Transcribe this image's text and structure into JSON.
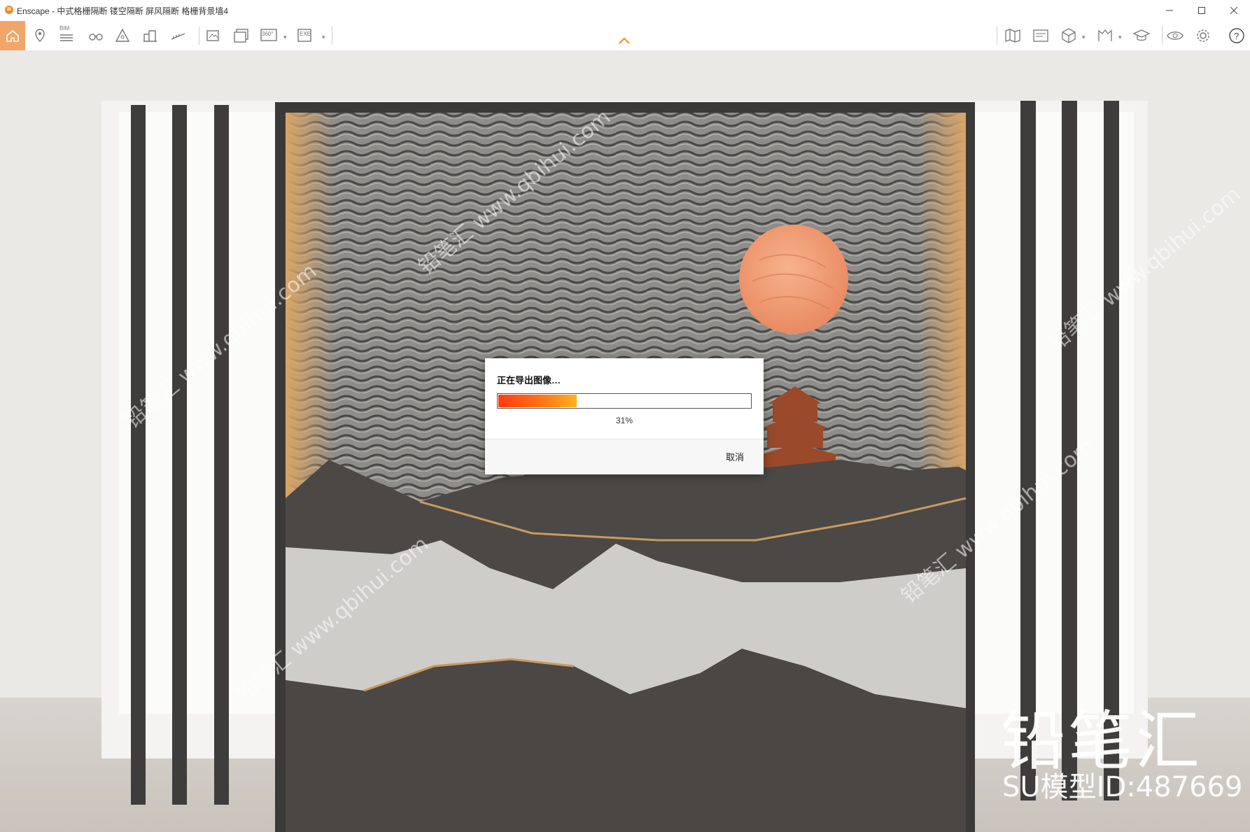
{
  "window": {
    "title": "Enscape - 中式格栅隔断 镂空隔断 屏风隔断 格栅背景墙4"
  },
  "toolbar": {
    "icons": [
      "home-icon",
      "location-pin-icon",
      "bim-list-icon",
      "binoculars-icon",
      "warning-icon",
      "buildings-icon",
      "ruler-icon",
      "screenshot-icon",
      "batch-render-icon",
      "panorama-360-icon",
      "exe-export-icon",
      "map-icon",
      "render-settings-icon",
      "cube-icon",
      "assets-icon",
      "graduation-cap-icon",
      "eye-icon",
      "gear-icon",
      "help-icon"
    ],
    "bim_label": "BIM",
    "panorama_label": "360°",
    "exe_label": "EXE",
    "accent_color": "#f2a56a"
  },
  "dialog": {
    "title": "正在导出图像…",
    "progress_percent": 31,
    "progress_label": "31%",
    "cancel_label": "取消"
  },
  "watermark": {
    "brand": "铅笔汇",
    "model_id": "SU模型ID:487669",
    "repeated_text": "铅笔汇 www.qbihui.com"
  }
}
